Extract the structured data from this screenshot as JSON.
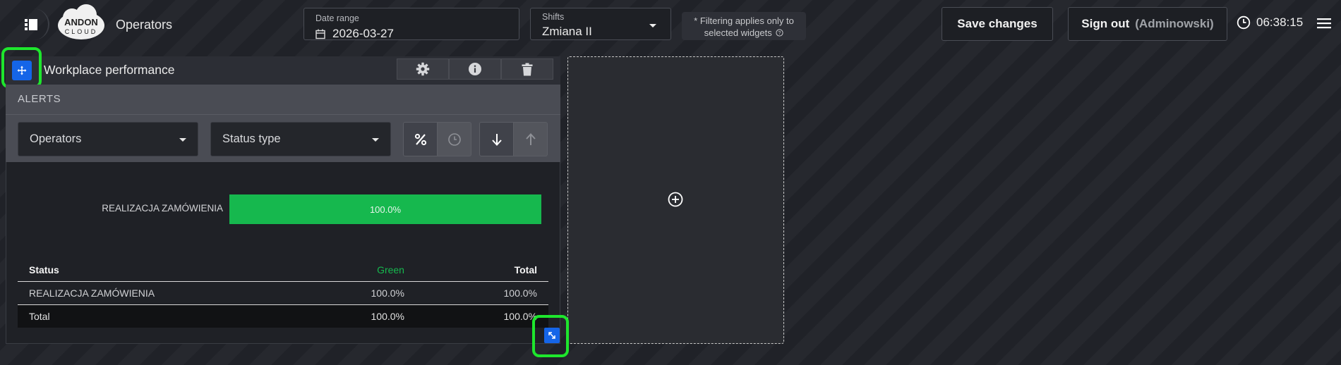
{
  "header": {
    "app_title": "Operators",
    "logo_text": "ANDON CLOUD",
    "date_range": {
      "label": "Date range",
      "value": "2026-03-27"
    },
    "shifts": {
      "label": "Shifts",
      "value": "Zmiana II"
    },
    "filter_note": {
      "line1": "* Filtering applies only to",
      "line2": "selected widgets"
    },
    "save_label": "Save changes",
    "signout_label": "Sign out",
    "user": "(Adminowski)",
    "time": "06:38:15"
  },
  "widget": {
    "title": "Workplace performance",
    "section_title": "ALERTS",
    "filters": {
      "operators": "Operators",
      "status_type": "Status type"
    },
    "bar": {
      "label": "REALIZACJA ZAMÓWIENIA",
      "value_text": "100.0%",
      "fraction": 1.0,
      "color": "#16b84e"
    },
    "table": {
      "headers": [
        "Status",
        "Green",
        "Total"
      ],
      "rows": [
        [
          "REALIZACJA ZAMÓWIENIA",
          "100.0%",
          "100.0%"
        ]
      ],
      "total": [
        "Total",
        "100.0%",
        "100.0%"
      ]
    }
  },
  "icons": [
    "sidebar-toggle-icon",
    "calendar-icon",
    "help-circle-icon",
    "clock-icon",
    "hamburger-icon",
    "move-icon",
    "gear-icon",
    "info-icon",
    "trash-icon",
    "percent-icon",
    "clock-outline-icon",
    "arrow-down-icon",
    "arrow-up-icon",
    "resize-icon",
    "add-circle-icon"
  ],
  "colors": {
    "accent": "#1565e8",
    "green": "#16b84e",
    "highlight": "#1ee62d"
  }
}
